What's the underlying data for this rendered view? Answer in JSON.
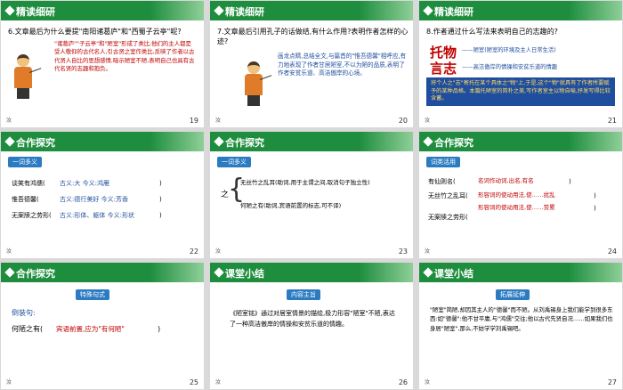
{
  "slides": [
    {
      "header": "精读细研",
      "question": "6.文章最后为什么要提\"南阳诸葛庐\"和\"西蜀子云亭\"呢?",
      "answer": "\"诸葛庐\"\"子云亭\"和\"陋室\"形成了类比,他们的主人都是受人敬仰的古代名人,引古贤之室作类比,反映了作者以古代贤人自比的思想感情,暗示陋室不陋,表明自己也具有古代名贤的志趣和抱负。",
      "page": "19",
      "footer": "汝"
    },
    {
      "header": "精读细研",
      "question": "7.文章最后引用孔子的话做结,有什么作用?表明作者怎样的心迹?",
      "answer": "画龙点睛,总结全文,与篇首的\"惟吾德馨\"相呼应,有力地表现了作者甘居陋室,不以为陋的品质,表明了作者安贫乐道、高洁傲岸的心境。",
      "page": "20",
      "footer": "汝"
    },
    {
      "header": "精读细研",
      "question": "8.作者通过什么写法来表明自己的志趣的?",
      "big1": "托物",
      "big2": "言志",
      "obj_line": "——陋室(陋室的环境及主人日常生活)",
      "mind_line": "——高洁傲岸的情操和安贫乐道的情趣",
      "box_text": "将个人之\"志\"寄托在某个具体之\"物\"上,于是,这个\"物\"就具有了作者所要赋予的某种品格。本篇托陋室的简朴之美,写作者室主以物自喻,抒发写得比较含蓄。",
      "page": "21",
      "footer": "汝"
    },
    {
      "header": "合作探究",
      "sub": "一词多义",
      "rows": [
        {
          "a": "谈笑有鸿儒(",
          "b": "古义:大    今义:鸿雁",
          "c": ")"
        },
        {
          "a": "惟吾德馨(",
          "b": "古义:德行美好    今义:芳香",
          "c": ")"
        },
        {
          "a": "无案牍之劳形(",
          "b": "古义:形体、躯体    今义:形状",
          "c": ")"
        }
      ],
      "page": "22",
      "footer": "汝"
    },
    {
      "header": "合作探究",
      "sub": "一词多义",
      "left": "之",
      "r1": "无丝竹之乱耳(助词,用于主谓之间,取消句子独立性)",
      "r2": "何陋之有(助词,宾语前置的标志,可不译)",
      "page": "23",
      "footer": "汝"
    },
    {
      "header": "合作探究",
      "sub": "词类活用",
      "rows": [
        {
          "a": "有仙则名(",
          "b": "名词作动词,出名,有名",
          "c": ")"
        },
        {
          "a": "无丝竹之乱耳(",
          "b": "形容词的使动用法,使……扰乱",
          "c": ")"
        },
        {
          "a": "",
          "b": "形容词的使动用法,使……劳累",
          "c": ")"
        },
        {
          "a": "无案牍之劳形(",
          "b": "",
          "c": ""
        }
      ],
      "page": "24",
      "footer": "汝"
    },
    {
      "header": "合作探究",
      "sub": "特殊句式",
      "label": "倒装句:",
      "sent": "何陋之有(",
      "note": "宾语前置,应为\"有何陋\"",
      "close": ")",
      "page": "25",
      "footer": "汝"
    },
    {
      "header": "课堂小结",
      "sub": "内容主旨",
      "text": "《陋室铭》通过对居室情景的描绘,极力形容\"陋室\"不陋,表达了一种高洁傲岸的情操和安贫乐道的情趣。",
      "page": "26",
      "footer": "汝"
    },
    {
      "header": "课堂小结",
      "sub": "拓展延伸",
      "text": "\"陋室\"简陋,却因其主人的\"德馨\"而不陋。从刘禹锡身上我们能学到很多东西:如\"德馨\":他不甘平庸,与\"鸿儒\"交往;他以古代先贤自况……如果我们也身居\"陋室\",那么,不妨学学刘禹锡吧。",
      "page": "27",
      "footer": "汝"
    }
  ]
}
